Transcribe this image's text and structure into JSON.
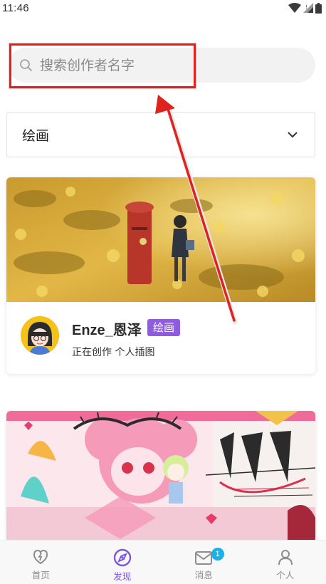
{
  "status_bar": {
    "time": "11:46"
  },
  "search": {
    "placeholder": "搜索创作者名字"
  },
  "category_filter": {
    "selected": "绘画"
  },
  "creators": [
    {
      "name": "Enze_恩泽",
      "category": "绘画",
      "description": "正在创作 个人插图"
    }
  ],
  "tab_bar": {
    "items": [
      {
        "label": "首页",
        "icon": "home-icon"
      },
      {
        "label": "发现",
        "icon": "discover-icon"
      },
      {
        "label": "消息",
        "icon": "message-icon",
        "badge": "1"
      },
      {
        "label": "个人",
        "icon": "profile-icon"
      }
    ],
    "active_index": 1
  },
  "colors": {
    "accent": "#8e5cdc",
    "badge": "#1ab0e8",
    "annotation": "#e0221e"
  }
}
